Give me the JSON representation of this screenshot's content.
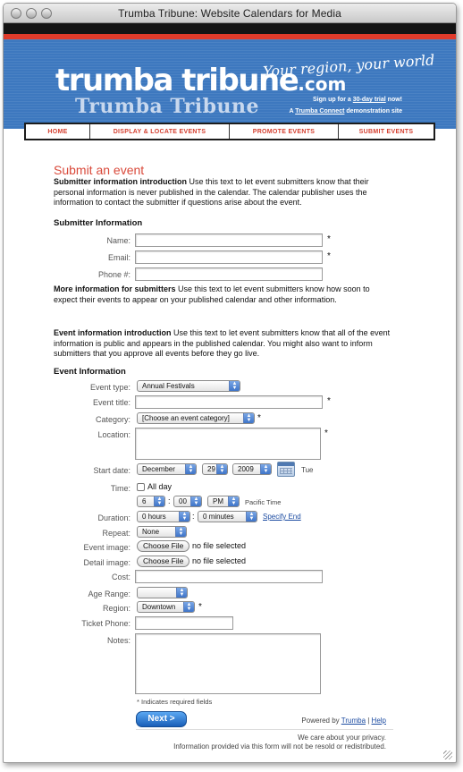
{
  "window": {
    "title": "Trumba Tribune: Website Calendars for Media"
  },
  "header": {
    "logo_main": "trumba tribune",
    "logo_com": ".com",
    "logo_sub": "Trumba Tribune",
    "tagline": "Your region, your world",
    "signup_prefix": "Sign up for a ",
    "signup_link": "30-day trial",
    "signup_suffix": " now!",
    "demo_prefix": "A ",
    "demo_link": "Trumba Connect",
    "demo_suffix": " demonstration site",
    "colors": {
      "band": "#3d78bf",
      "red": "#e03b2b",
      "nav_text": "#d43f2f"
    }
  },
  "nav": {
    "items": [
      {
        "label": "HOME"
      },
      {
        "label": "DISPLAY & LOCATE EVENTS"
      },
      {
        "label": "PROMOTE EVENTS"
      },
      {
        "label": "SUBMIT EVENTS"
      }
    ]
  },
  "page": {
    "heading": "Submit an event",
    "intro_bold": "Submitter information introduction",
    "intro_text": " Use this text to let event submitters know that their personal information is never published in the calendar. The calendar publisher uses the information to contact the submitter if questions arise about the event.",
    "submitter_section": "Submitter Information",
    "more_bold": "More information for submitters",
    "more_text": " Use this text to let event submitters know how soon to expect their events to appear on your published calendar and other information.",
    "event_intro_bold": "Event information introduction",
    "event_intro_text": " Use this text to let event submitters know that all of the event information is public and appears in the published calendar. You might also want to inform submitters that you approve all events before they go live.",
    "event_section": "Event Information"
  },
  "submitter": {
    "name_label": "Name:",
    "email_label": "Email:",
    "phone_label": "Phone #:",
    "required_mark": "*"
  },
  "event": {
    "type_label": "Event type:",
    "type_value": "Annual Festivals",
    "title_label": "Event title:",
    "category_label": "Category:",
    "category_value": "[Choose an event category]",
    "location_label": "Location:",
    "start_label": "Start date:",
    "start_month": "December",
    "start_day": "29",
    "start_year": "2009",
    "start_weekday": "Tue",
    "time_label": "Time:",
    "allday_label": "All day",
    "hour": "6",
    "minute": "00",
    "ampm": "PM",
    "time_sep": ":",
    "timezone": "Pacific Time",
    "duration_label": "Duration:",
    "duration_hours": "0 hours",
    "duration_minutes": "0 minutes",
    "specify_end": "Specify End",
    "repeat_label": "Repeat:",
    "repeat_value": "None",
    "event_image_label": "Event image:",
    "detail_image_label": "Detail image:",
    "choose_file": "Choose File",
    "no_file": "no file selected",
    "cost_label": "Cost:",
    "age_label": "Age Range:",
    "age_value": "",
    "region_label": "Region:",
    "region_value": "Downtown",
    "ticket_label": "Ticket Phone:",
    "notes_label": "Notes:",
    "required_note": "* Indicates required fields"
  },
  "footer": {
    "next_label": "Next >",
    "powered_prefix": "Powered by ",
    "powered_link": "Trumba",
    "powered_sep": " | ",
    "help_link": "Help",
    "privacy_line1": "We care about your privacy.",
    "privacy_line2": "Information provided via this form will not be resold or redistributed."
  }
}
